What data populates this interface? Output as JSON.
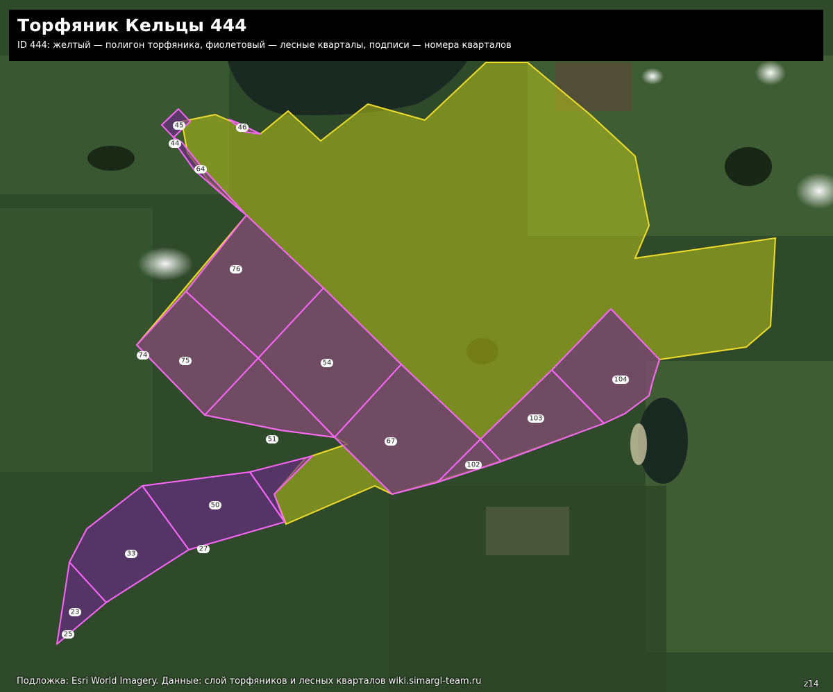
{
  "header": {
    "title": "Торфяник Кельцы 444",
    "subtitle": "ID 444: желтый — полигон торфяника, фиолетовый — лесные кварталы, подписи — номера кварталов"
  },
  "footer": {
    "attribution": "Подложка: Esri World Imagery. Данные: слой торфяников и лесных кварталов wiki.simargl-team.ru",
    "zoom": "z14"
  },
  "colors": {
    "peat_fill": "#b8c21a",
    "peat_stroke": "#f0dc2a",
    "quarter_fill": "#6a2a86",
    "quarter_stroke": "#ff66ff",
    "label_bg": "#ffffff",
    "background_forest": "#2f4a2a",
    "water": "#1a2a22"
  },
  "quarters": {
    "q23": "23",
    "q25": "25",
    "q27": "27",
    "q33": "33",
    "q44": "44",
    "q45": "45",
    "q46": "46",
    "q50": "50",
    "q51": "51",
    "q54": "54",
    "q64": "64",
    "q67": "67",
    "q74": "74",
    "q75": "75",
    "q76": "76",
    "q102": "102",
    "q103": "103",
    "q104": "104"
  }
}
